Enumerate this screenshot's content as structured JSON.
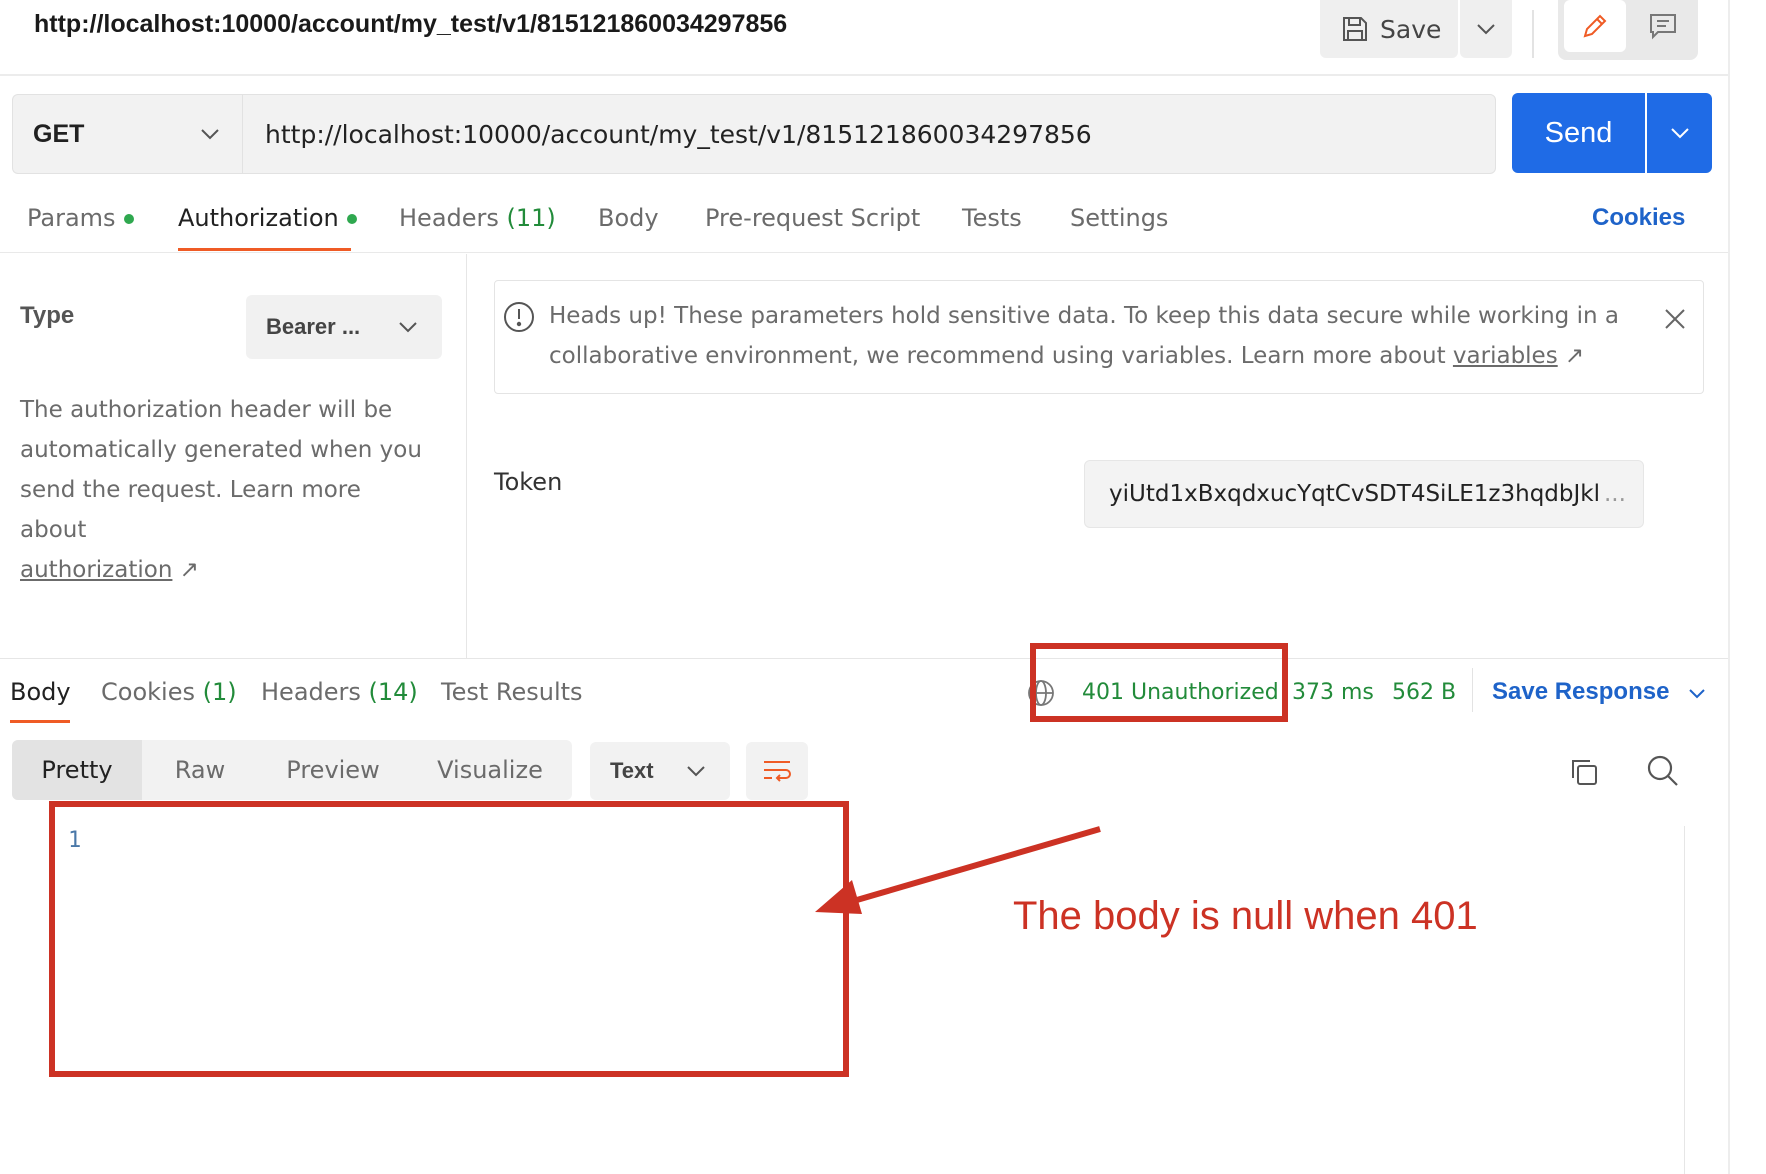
{
  "title_bar": {
    "url": "http://localhost:10000/account/my_test/v1/815121860034297856",
    "save_label": "Save"
  },
  "request": {
    "method": "GET",
    "url": "http://localhost:10000/account/my_test/v1/815121860034297856",
    "send_label": "Send"
  },
  "request_tabs": {
    "params": "Params",
    "authorization": "Authorization",
    "headers": "Headers",
    "headers_count": "(11)",
    "body": "Body",
    "pre_request": "Pre-request Script",
    "tests": "Tests",
    "settings": "Settings",
    "cookies": "Cookies",
    "active": "Authorization"
  },
  "auth": {
    "type_label": "Type",
    "type_value": "Bearer ...",
    "description": "The authorization header will be automatically generated when you send the request. Learn more about",
    "link": "authorization"
  },
  "alert": {
    "text": "Heads up! These parameters hold sensitive data. To keep this data secure while working in a collaborative environment, we recommend using variables. Learn more about",
    "link": "variables"
  },
  "token": {
    "label": "Token",
    "value": "yiUtd1xBxqdxucYqtCvSDT4SiLE1z3hqdbJkl",
    "ellipsis": "..."
  },
  "response_tabs": {
    "body": "Body",
    "cookies": "Cookies",
    "cookies_count": "(1)",
    "headers": "Headers",
    "headers_count": "(14)",
    "test_results": "Test Results",
    "active": "Body"
  },
  "response_status": {
    "status": "401 Unauthorized",
    "time": "373 ms",
    "size": "562 B",
    "save_response": "Save Response"
  },
  "view_toolbar": {
    "pretty": "Pretty",
    "raw": "Raw",
    "preview": "Preview",
    "visualize": "Visualize",
    "format": "Text",
    "active": "Pretty"
  },
  "editor": {
    "line_numbers": [
      "1"
    ]
  },
  "annotation": {
    "note": "The body is null when 401",
    "color": "#cc3224"
  },
  "colors": {
    "accent_orange": "#ef5b25",
    "send_blue": "#1f6be6",
    "link_blue": "#1e63c9",
    "status_green": "#228b3a",
    "active_dot": "#2fa84f"
  },
  "icons": [
    "save-icon",
    "chevron-down-icon",
    "pencil-icon",
    "comment-icon",
    "info-icon",
    "close-icon",
    "external-link-icon",
    "globe-icon",
    "wrap-lines-icon",
    "copy-icon",
    "search-icon"
  ]
}
